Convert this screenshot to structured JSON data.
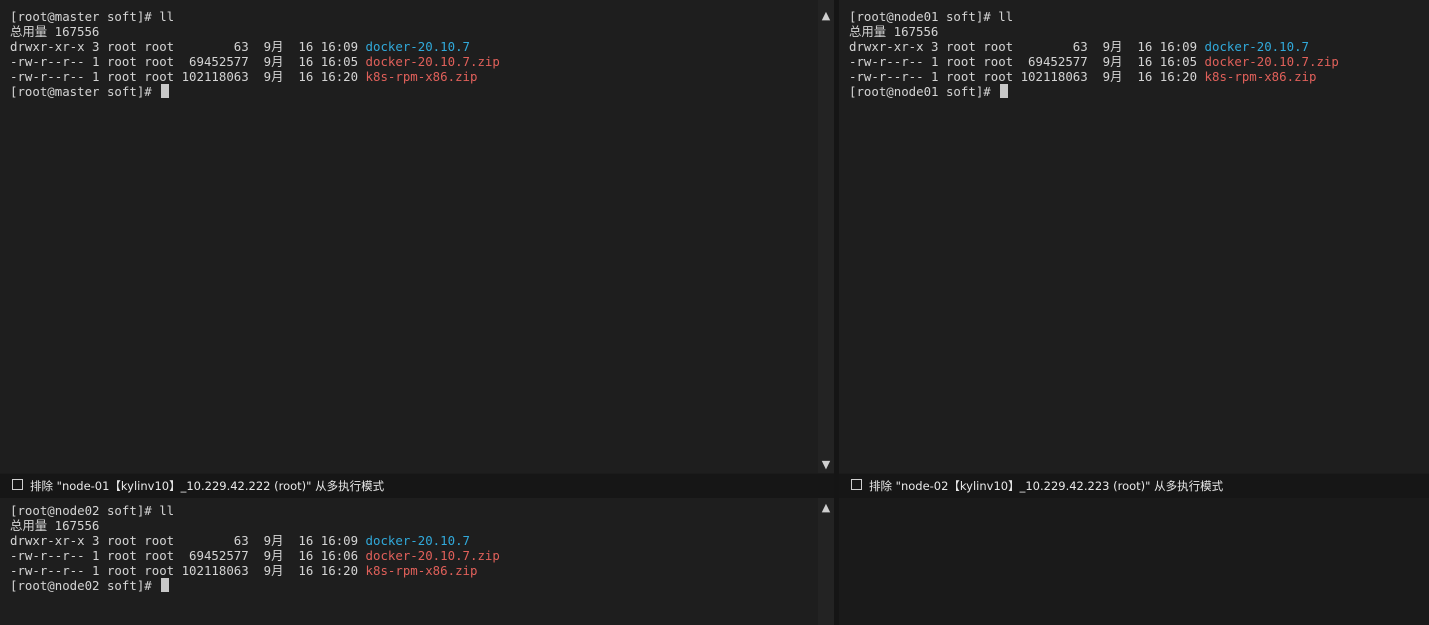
{
  "panes": [
    {
      "id": "master",
      "lines": [
        [
          {
            "t": "[root@master soft]# ll"
          }
        ],
        [
          {
            "t": "总用量 167556"
          }
        ],
        [
          {
            "t": "drwxr-xr-x 3 root root        63  9月  16 16:09 "
          },
          {
            "t": "docker-20.10.7",
            "c": "dir"
          }
        ],
        [
          {
            "t": "-rw-r--r-- 1 root root  69452577  9月  16 16:05 "
          },
          {
            "t": "docker-20.10.7.zip",
            "c": "zip"
          }
        ],
        [
          {
            "t": "-rw-r--r-- 1 root root 102118063  9月  16 16:20 "
          },
          {
            "t": "k8s-rpm-x86.zip",
            "c": "zip"
          }
        ],
        [
          {
            "t": "[root@master soft]# "
          },
          {
            "cursor": true
          }
        ]
      ]
    },
    {
      "id": "node01",
      "lines": [
        [
          {
            "t": "[root@node01 soft]# ll"
          }
        ],
        [
          {
            "t": "总用量 167556"
          }
        ],
        [
          {
            "t": "drwxr-xr-x 3 root root        63  9月  16 16:09 "
          },
          {
            "t": "docker-20.10.7",
            "c": "dir"
          }
        ],
        [
          {
            "t": "-rw-r--r-- 1 root root  69452577  9月  16 16:05 "
          },
          {
            "t": "docker-20.10.7.zip",
            "c": "zip"
          }
        ],
        [
          {
            "t": "-rw-r--r-- 1 root root 102118063  9月  16 16:20 "
          },
          {
            "t": "k8s-rpm-x86.zip",
            "c": "zip"
          }
        ],
        [
          {
            "t": "[root@node01 soft]# "
          },
          {
            "cursor": true
          }
        ]
      ]
    },
    {
      "id": "node02",
      "lines": [
        [
          {
            "t": "[root@node02 soft]# ll"
          }
        ],
        [
          {
            "t": "总用量 167556"
          }
        ],
        [
          {
            "t": "drwxr-xr-x 3 root root        63  9月  16 16:09 "
          },
          {
            "t": "docker-20.10.7",
            "c": "dir"
          }
        ],
        [
          {
            "t": "-rw-r--r-- 1 root root  69452577  9月  16 16:06 "
          },
          {
            "t": "docker-20.10.7.zip",
            "c": "zip"
          }
        ],
        [
          {
            "t": "-rw-r--r-- 1 root root 102118063  9月  16 16:20 "
          },
          {
            "t": "k8s-rpm-x86.zip",
            "c": "zip"
          }
        ],
        [
          {
            "t": "[root@node02 soft]# "
          },
          {
            "cursor": true
          }
        ]
      ]
    }
  ],
  "status": {
    "left_label": "排除 \"node-01【kylinv10】_10.229.42.222 (root)\" 从多执行模式",
    "right_label": "排除 \"node-02【kylinv10】_10.229.42.223 (root)\" 从多执行模式"
  },
  "scroll_arrows": {
    "up": "▲",
    "down": "▼"
  },
  "colors": {
    "dir": "#31a9da",
    "zip": "#e0605a",
    "background": "#1e1e1e"
  }
}
